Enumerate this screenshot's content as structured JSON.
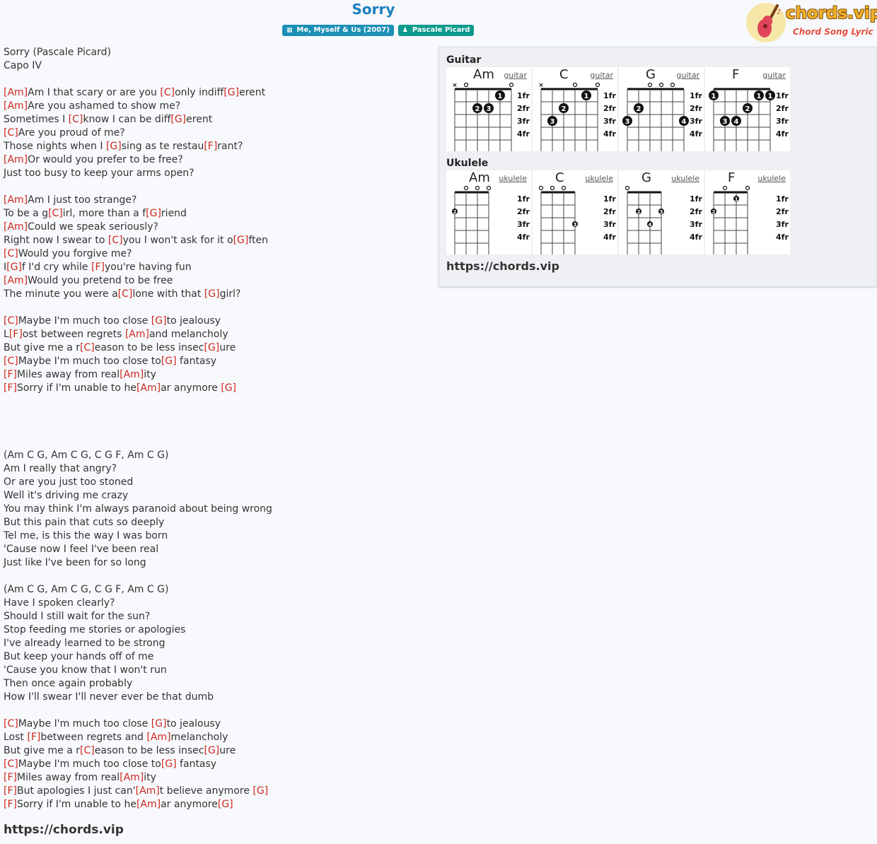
{
  "song": {
    "title": "Sorry"
  },
  "badges": {
    "album": "Me, Myself & Us (2007)",
    "artist": "Pascale Picard"
  },
  "logo": {
    "name": "chords.vip",
    "tagline": "Chord Song Lyric"
  },
  "lyrics": [
    [
      [
        "t",
        "Sorry (Pascale Picard)"
      ]
    ],
    [
      [
        "t",
        "Capo IV"
      ]
    ],
    [],
    [
      [
        "c",
        "[Am]"
      ],
      [
        "t",
        "Am I that scary or are you "
      ],
      [
        "c",
        "[C]"
      ],
      [
        "t",
        "only indiff"
      ],
      [
        "c",
        "[G]"
      ],
      [
        "t",
        "erent"
      ]
    ],
    [
      [
        "c",
        "[Am]"
      ],
      [
        "t",
        "Are you ashamed to show me?"
      ]
    ],
    [
      [
        "t",
        "Sometimes I "
      ],
      [
        "c",
        "[C]"
      ],
      [
        "t",
        "know I can be diff"
      ],
      [
        "c",
        "[G]"
      ],
      [
        "t",
        "erent"
      ]
    ],
    [
      [
        "c",
        "[C]"
      ],
      [
        "t",
        "Are you proud of me?"
      ]
    ],
    [
      [
        "t",
        "Those nights when I "
      ],
      [
        "c",
        "[G]"
      ],
      [
        "t",
        "sing as te restau"
      ],
      [
        "c",
        "[F]"
      ],
      [
        "t",
        "rant?"
      ]
    ],
    [
      [
        "c",
        "[Am]"
      ],
      [
        "t",
        "Or would you prefer to be free?"
      ]
    ],
    [
      [
        "t",
        "Just too busy to keep your arms open?"
      ]
    ],
    [],
    [
      [
        "c",
        "[Am]"
      ],
      [
        "t",
        "Am I just too strange?"
      ]
    ],
    [
      [
        "t",
        "To be a g"
      ],
      [
        "c",
        "[C]"
      ],
      [
        "t",
        "irl, more than a f"
      ],
      [
        "c",
        "[G]"
      ],
      [
        "t",
        "riend"
      ]
    ],
    [
      [
        "c",
        "[Am]"
      ],
      [
        "t",
        "Could we speak seriously?"
      ]
    ],
    [
      [
        "t",
        "Right now I swear to "
      ],
      [
        "c",
        "[C]"
      ],
      [
        "t",
        "you I won't ask for it o"
      ],
      [
        "c",
        "[G]"
      ],
      [
        "t",
        "ften"
      ]
    ],
    [
      [
        "c",
        "[C]"
      ],
      [
        "t",
        "Would you forgive me?"
      ]
    ],
    [
      [
        "t",
        "I"
      ],
      [
        "c",
        "[G]"
      ],
      [
        "t",
        "f I'd cry while "
      ],
      [
        "c",
        "[F]"
      ],
      [
        "t",
        "you're having fun"
      ]
    ],
    [
      [
        "c",
        "[Am]"
      ],
      [
        "t",
        "Would you pretend to be free"
      ]
    ],
    [
      [
        "t",
        "The minute you were a"
      ],
      [
        "c",
        "[C]"
      ],
      [
        "t",
        "lone with that "
      ],
      [
        "c",
        "[G]"
      ],
      [
        "t",
        "girl?"
      ]
    ],
    [],
    [
      [
        "c",
        "[C]"
      ],
      [
        "t",
        "Maybe I'm much too close "
      ],
      [
        "c",
        "[G]"
      ],
      [
        "t",
        "to jealousy"
      ]
    ],
    [
      [
        "t",
        "L"
      ],
      [
        "c",
        "[F]"
      ],
      [
        "t",
        "ost between regrets "
      ],
      [
        "c",
        "[Am]"
      ],
      [
        "t",
        "and melancholy"
      ]
    ],
    [
      [
        "t",
        "But give me a r"
      ],
      [
        "c",
        "[C]"
      ],
      [
        "t",
        "eason to be less insec"
      ],
      [
        "c",
        "[G]"
      ],
      [
        "t",
        "ure"
      ]
    ],
    [
      [
        "c",
        "[C]"
      ],
      [
        "t",
        "Maybe I'm much too close to"
      ],
      [
        "c",
        "[G]"
      ],
      [
        "t",
        " fantasy"
      ]
    ],
    [
      [
        "c",
        "[F]"
      ],
      [
        "t",
        "Miles away from real"
      ],
      [
        "c",
        "[Am]"
      ],
      [
        "t",
        "ity"
      ]
    ],
    [
      [
        "c",
        "[F]"
      ],
      [
        "t",
        "Sorry if I'm unable to he"
      ],
      [
        "c",
        "[Am]"
      ],
      [
        "t",
        "ar anymore "
      ],
      [
        "c",
        "[G]"
      ]
    ],
    [],
    [],
    [],
    [],
    [
      [
        "t",
        "(Am C G, Am C G, C G F, Am C G)"
      ]
    ],
    [
      [
        "t",
        "Am I really that angry?"
      ]
    ],
    [
      [
        "t",
        "Or are you just too stoned"
      ]
    ],
    [
      [
        "t",
        "Well it's driving me crazy"
      ]
    ],
    [
      [
        "t",
        "You may think I'm always paranoid about being wrong"
      ]
    ],
    [
      [
        "t",
        "But this pain that cuts so deeply"
      ]
    ],
    [
      [
        "t",
        "Tel me, is this the way I was born"
      ]
    ],
    [
      [
        "t",
        "'Cause now I feel I've been real"
      ]
    ],
    [
      [
        "t",
        "Just like I've been for so long"
      ]
    ],
    [],
    [
      [
        "t",
        "(Am C G, Am C G, C G F, Am C G)"
      ]
    ],
    [
      [
        "t",
        "Have I spoken clearly?"
      ]
    ],
    [
      [
        "t",
        "Should I still wait for the sun?"
      ]
    ],
    [
      [
        "t",
        "Stop feeding me stories or apologies"
      ]
    ],
    [
      [
        "t",
        "I've already learned to be strong"
      ]
    ],
    [
      [
        "t",
        "But keep your hands off of me"
      ]
    ],
    [
      [
        "t",
        "'Cause you know that I won't run"
      ]
    ],
    [
      [
        "t",
        "Then once again probably"
      ]
    ],
    [
      [
        "t",
        "How I'll swear I'll never ever be that dumb"
      ]
    ],
    [],
    [
      [
        "c",
        "[C]"
      ],
      [
        "t",
        "Maybe I'm much too close "
      ],
      [
        "c",
        "[G]"
      ],
      [
        "t",
        "to jealousy"
      ]
    ],
    [
      [
        "t",
        "Lost "
      ],
      [
        "c",
        "[F]"
      ],
      [
        "t",
        "between regrets and "
      ],
      [
        "c",
        "[Am]"
      ],
      [
        "t",
        "melancholy"
      ]
    ],
    [
      [
        "t",
        "But give me a r"
      ],
      [
        "c",
        "[C]"
      ],
      [
        "t",
        "eason to be less insec"
      ],
      [
        "c",
        "[G]"
      ],
      [
        "t",
        "ure"
      ]
    ],
    [
      [
        "c",
        "[C]"
      ],
      [
        "t",
        "Maybe I'm much too close to"
      ],
      [
        "c",
        "[G]"
      ],
      [
        "t",
        " fantasy"
      ]
    ],
    [
      [
        "c",
        "[F]"
      ],
      [
        "t",
        "Miles away from real"
      ],
      [
        "c",
        "[Am]"
      ],
      [
        "t",
        "ity"
      ]
    ],
    [
      [
        "c",
        "[F]"
      ],
      [
        "t",
        "But apologies I just can'"
      ],
      [
        "c",
        "[Am]"
      ],
      [
        "t",
        "t believe anymore "
      ],
      [
        "c",
        "[G]"
      ]
    ],
    [
      [
        "c",
        "[F]"
      ],
      [
        "t",
        "Sorry if I'm unable to he"
      ],
      [
        "c",
        "[Am]"
      ],
      [
        "t",
        "ar anymore"
      ],
      [
        "c",
        "[G]"
      ]
    ]
  ],
  "footer": {
    "url": "https://chords.vip"
  },
  "panel": {
    "guitar_title": "Guitar",
    "ukulele_title": "Ukulele",
    "url": "https://chords.vip",
    "fret_labels": [
      "1fr",
      "2fr",
      "3fr",
      "4fr"
    ],
    "guitar": [
      {
        "name": "Am",
        "link": "guitar",
        "marks": [
          "x",
          "o",
          "",
          "",
          "",
          "o"
        ],
        "dots": [
          [
            4,
            1,
            "1"
          ],
          [
            2,
            2,
            "2"
          ],
          [
            3,
            2,
            "3"
          ]
        ]
      },
      {
        "name": "C",
        "link": "guitar",
        "marks": [
          "x",
          "",
          "",
          "o",
          "",
          "o"
        ],
        "dots": [
          [
            4,
            1,
            "1"
          ],
          [
            2,
            2,
            "2"
          ],
          [
            1,
            3,
            "3"
          ]
        ]
      },
      {
        "name": "G",
        "link": "guitar",
        "marks": [
          "",
          "",
          "o",
          "o",
          "o",
          ""
        ],
        "dots": [
          [
            1,
            2,
            "2"
          ],
          [
            0,
            3,
            "3"
          ],
          [
            5,
            3,
            "4"
          ]
        ]
      },
      {
        "name": "F",
        "link": "guitar",
        "marks": [
          "",
          "",
          "",
          "",
          "",
          ""
        ],
        "dots": [
          [
            0,
            1,
            "1"
          ],
          [
            4,
            1,
            "1"
          ],
          [
            5,
            1,
            "1"
          ],
          [
            3,
            2,
            "2"
          ],
          [
            1,
            3,
            "3"
          ],
          [
            2,
            3,
            "4"
          ]
        ]
      }
    ],
    "ukulele": [
      {
        "name": "Am",
        "link": "ukulele",
        "marks": [
          "",
          "o",
          "o",
          "o"
        ],
        "dots": [
          [
            0,
            2,
            "2"
          ]
        ]
      },
      {
        "name": "C",
        "link": "ukulele",
        "marks": [
          "o",
          "o",
          "o",
          ""
        ],
        "dots": [
          [
            3,
            3,
            "3"
          ]
        ]
      },
      {
        "name": "G",
        "link": "ukulele",
        "marks": [
          "o",
          "",
          "",
          ""
        ],
        "dots": [
          [
            1,
            2,
            "2"
          ],
          [
            3,
            2,
            "3"
          ],
          [
            2,
            3,
            "4"
          ]
        ]
      },
      {
        "name": "F",
        "link": "ukulele",
        "marks": [
          "",
          "o",
          "",
          "o"
        ],
        "dots": [
          [
            0,
            2,
            "2"
          ],
          [
            2,
            1,
            "1"
          ]
        ]
      }
    ]
  }
}
